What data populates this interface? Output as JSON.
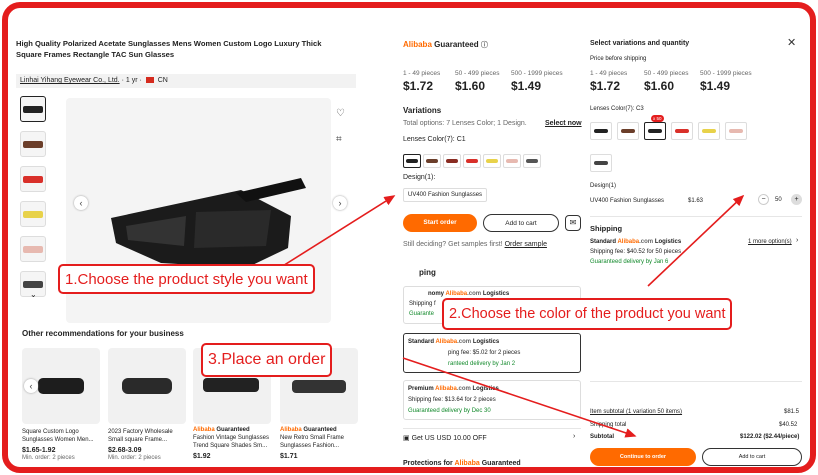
{
  "product": {
    "title": "High Quality Polarized Acetate Sunglasses Mens Women Custom Logo Luxury Thick Square Frames Rectangle TAC Sun Glasses",
    "supplier": "Linhai Yihang Eyewear Co., Ltd.",
    "years": "· 1 yr ·",
    "country": "CN"
  },
  "recommendations": {
    "title": "Other recommendations for your business",
    "items": [
      {
        "caption": "Square Custom Logo Sunglasses Women Men...",
        "price": "$1.65-1.92",
        "moq": "Min. order: 2 pieces"
      },
      {
        "caption": "2023 Factory Wholesale Small square Frame...",
        "price": "$2.68-3.09",
        "moq": "Min. order: 2 pieces"
      },
      {
        "caption": "Fashion Vintage Sunglasses Trend Square Shades Sm...",
        "price": "$1.92",
        "moq": "",
        "badge": "Alibaba Guaranteed"
      },
      {
        "caption": "New Retro Small Frame Sunglasses Fashion...",
        "price": "$1.71",
        "moq": "",
        "badge": "Alibaba Guaranteed"
      }
    ]
  },
  "middle": {
    "brand_a": "Alibaba",
    "brand_b": "Guaranteed",
    "tiers": [
      {
        "qty": "1 - 49 pieces",
        "price": "$1.72"
      },
      {
        "qty": "50 - 499 pieces",
        "price": "$1.60"
      },
      {
        "qty": "500 - 1999 pieces",
        "price": "$1.49"
      }
    ],
    "variations_title": "Variations",
    "total_options": "Total options: 7 Lenses Color; 1 Design.",
    "select_now": "Select now",
    "lens_label": "Lenses Color(7): C1",
    "design_label": "Design(1):",
    "design_value": "UV400 Fashion Sunglasses",
    "start_order": "Start order",
    "add_to_cart": "Add to cart",
    "deciding": "Still deciding? Get samples first!",
    "order_sample": "Order sample",
    "shipping_partial": "ping",
    "ship_options": [
      {
        "name": "nomy",
        "fee": "Shipping f",
        "delivery": "Guarante"
      },
      {
        "name": "Standard",
        "fee": "ping fee: $5.02 for 2 pieces",
        "delivery": "ranteed delivery by Jan 2"
      },
      {
        "name": "Premium",
        "fee": "Shipping fee: $13.64 for 2 pieces",
        "delivery": "Guaranteed delivery by Dec 30"
      }
    ],
    "logistics": "Logistics",
    "coupon": "Get US USD 10.00 OFF",
    "protections": "Protections for"
  },
  "right": {
    "title": "Select variations and quantity",
    "price_before": "Price before shipping",
    "tiers": [
      {
        "qty": "1 - 49 pieces",
        "price": "$1.72"
      },
      {
        "qty": "50 - 499 pieces",
        "price": "$1.60"
      },
      {
        "qty": "500 - 1999 pieces",
        "price": "$1.49"
      }
    ],
    "lens_label": "Lenses Color(7): C3",
    "badge": "x 50",
    "design_label": "Design(1)",
    "design_name": "UV400 Fashion Sunglasses",
    "design_price": "$1.63",
    "qty": "50",
    "shipping_title": "Shipping",
    "ship_name": "Standard",
    "ship_fee": "Shipping fee: $40.52 for 50 pieces",
    "ship_delivery": "Guaranteed delivery by Jan 6",
    "more_options": "1 more option(s)",
    "item_subtotal_label": "Item subtotal (1 variation 50 items)",
    "item_subtotal": "$81.5",
    "shipping_total_label": "Shipping total",
    "shipping_total": "$40.52",
    "subtotal_label": "Subtotal",
    "subtotal": "$122.02 ($2.44/piece)",
    "continue": "Continue to order",
    "add_to_cart": "Add to cart"
  },
  "callouts": {
    "one": "1.Choose the product style you want",
    "two": "2.Choose the color of the product you want",
    "three": "3.Place an order"
  },
  "colors": {
    "accent": "#ff6a00",
    "annotation": "#e41d1d",
    "green": "#138a2c"
  }
}
